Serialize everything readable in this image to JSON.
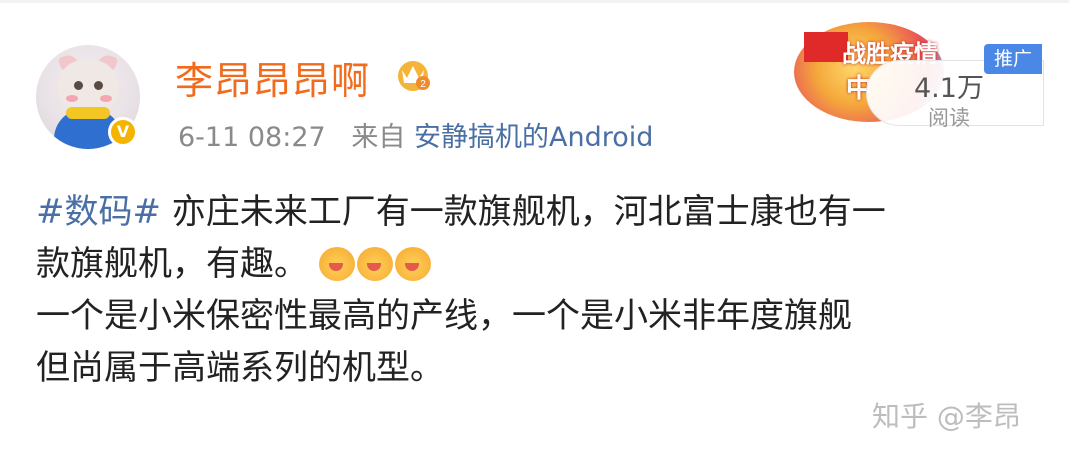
{
  "post": {
    "username": "李昂昂昂啊",
    "verified_badge": "V",
    "time": "6-11 08:27",
    "source_prefix": "来自",
    "source": "安静搞机的Android",
    "topic": "#数码#",
    "line1_rest": "亦庄未来工厂有一款旗舰机，河北富士康也有一",
    "line2": "款旗舰机，有趣。",
    "line3": "一个是小米保密性最高的产线，一个是小米非年度旗舰",
    "line4": "但尚属于高端系列的机型。",
    "emoji_name": "heart-eyes-emoji",
    "emoji_count": 3
  },
  "promo": {
    "title": "战胜疫情",
    "subtitle": "中",
    "tag": "推广",
    "reads_count": "4.1万",
    "reads_label": "阅读"
  },
  "watermark": "知乎 @李昂",
  "colors": {
    "username": "#f26a1b",
    "link": "#4a6fa5",
    "meta": "#8a8a8a",
    "promo_tag": "#4a87e6"
  }
}
